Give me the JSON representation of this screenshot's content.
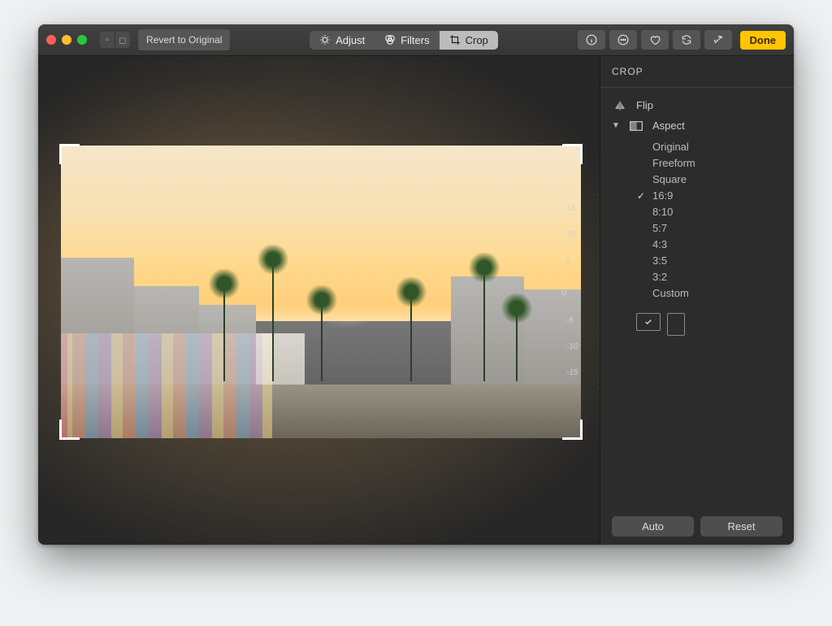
{
  "toolbar": {
    "revert_label": "Revert to Original",
    "modes": {
      "adjust": "Adjust",
      "filters": "Filters",
      "crop": "Crop"
    },
    "done_label": "Done"
  },
  "sidebar": {
    "title": "CROP",
    "flip_label": "Flip",
    "aspect_label": "Aspect",
    "aspect_options": [
      "Original",
      "Freeform",
      "Square",
      "16:9",
      "8:10",
      "5:7",
      "4:3",
      "3:5",
      "3:2",
      "Custom"
    ],
    "aspect_selected": "16:9",
    "footer": {
      "auto": "Auto",
      "reset": "Reset"
    }
  },
  "dial": {
    "labels_up": [
      "5",
      "10",
      "15"
    ],
    "center": "0",
    "labels_down": [
      "-5",
      "-10",
      "-15"
    ]
  }
}
